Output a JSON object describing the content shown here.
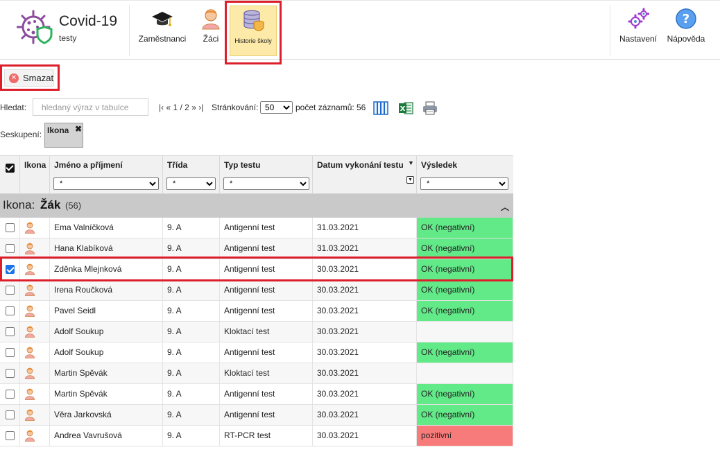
{
  "app": {
    "title": "Covid-19",
    "subtitle": "testy"
  },
  "toolbar": {
    "left_buttons": [
      {
        "label": "Zaměstnanci",
        "icon": "graduation-cap-icon"
      },
      {
        "label": "Žáci",
        "icon": "student-icon"
      },
      {
        "label": "Historie školy",
        "icon": "database-shield-icon",
        "active": true
      }
    ],
    "right_buttons": [
      {
        "label": "Nastavení",
        "icon": "gears-icon"
      },
      {
        "label": "Nápověda",
        "icon": "help-icon"
      }
    ]
  },
  "actions": {
    "delete_label": "Smazat"
  },
  "search": {
    "label": "Hledat:",
    "placeholder": "hledaný výraz v tabulce"
  },
  "pager": {
    "first": "|‹",
    "prev": "«",
    "status": "1 / 2",
    "next": "»",
    "last": "›|"
  },
  "paging": {
    "label": "Stránkování:",
    "selected": "50"
  },
  "records": {
    "label": "počet záznamů:",
    "count": "56"
  },
  "grouping": {
    "label": "Seskupení:",
    "chip": "Ikona",
    "chip_remove": "✖"
  },
  "table": {
    "columns": [
      {
        "label": "Ikona"
      },
      {
        "label": "Jméno a příjmení",
        "filter": "*"
      },
      {
        "label": "Třída",
        "filter": "*"
      },
      {
        "label": "Typ testu",
        "filter": "*"
      },
      {
        "label": "Datum vykonání testu",
        "sort": "▼"
      },
      {
        "label": "Výsledek",
        "filter": "*"
      }
    ],
    "group": {
      "prefix": "Ikona:",
      "name": "Žák",
      "count": "(56)"
    },
    "rows": [
      {
        "name": "Ema Valníčková",
        "class": "9. A",
        "type": "Antigenní test",
        "date": "31.03.2021",
        "result": "OK (negativní)",
        "status": "ok",
        "checked": false
      },
      {
        "name": "Hana Klabíková",
        "class": "9. A",
        "type": "Antigenní test",
        "date": "31.03.2021",
        "result": "OK (negativní)",
        "status": "ok",
        "checked": false
      },
      {
        "name": "Zděnka Mlejnková",
        "class": "9. A",
        "type": "Antigenní test",
        "date": "30.03.2021",
        "result": "OK (negativní)",
        "status": "ok",
        "checked": true
      },
      {
        "name": "Irena Roučková",
        "class": "9. A",
        "type": "Antigenní test",
        "date": "30.03.2021",
        "result": "OK (negativní)",
        "status": "ok",
        "checked": false
      },
      {
        "name": "Pavel Seidl",
        "class": "9. A",
        "type": "Antigenní test",
        "date": "30.03.2021",
        "result": "OK (negativní)",
        "status": "ok",
        "checked": false
      },
      {
        "name": "Adolf Soukup",
        "class": "9. A",
        "type": "Kloktací test",
        "date": "30.03.2021",
        "result": "",
        "status": "none",
        "checked": false
      },
      {
        "name": "Adolf Soukup",
        "class": "9. A",
        "type": "Antigenní test",
        "date": "30.03.2021",
        "result": "OK (negativní)",
        "status": "ok",
        "checked": false
      },
      {
        "name": "Martin Spěvák",
        "class": "9. A",
        "type": "Kloktací test",
        "date": "30.03.2021",
        "result": "",
        "status": "none",
        "checked": false
      },
      {
        "name": "Martin Spěvák",
        "class": "9. A",
        "type": "Antigenní test",
        "date": "30.03.2021",
        "result": "OK (negativní)",
        "status": "ok",
        "checked": false
      },
      {
        "name": "Věra Jarkovská",
        "class": "9. A",
        "type": "Antigenní test",
        "date": "30.03.2021",
        "result": "OK (negativní)",
        "status": "ok",
        "checked": false
      },
      {
        "name": "Andrea Vavrušová",
        "class": "9. A",
        "type": "RT-PCR test",
        "date": "30.03.2021",
        "result": "pozitivní",
        "status": "positive",
        "checked": false
      }
    ]
  },
  "colors": {
    "ok": "#63ea88",
    "positive": "#f87b7b",
    "highlight": "#dc1f2a",
    "active_tab": "#fde9a8"
  }
}
